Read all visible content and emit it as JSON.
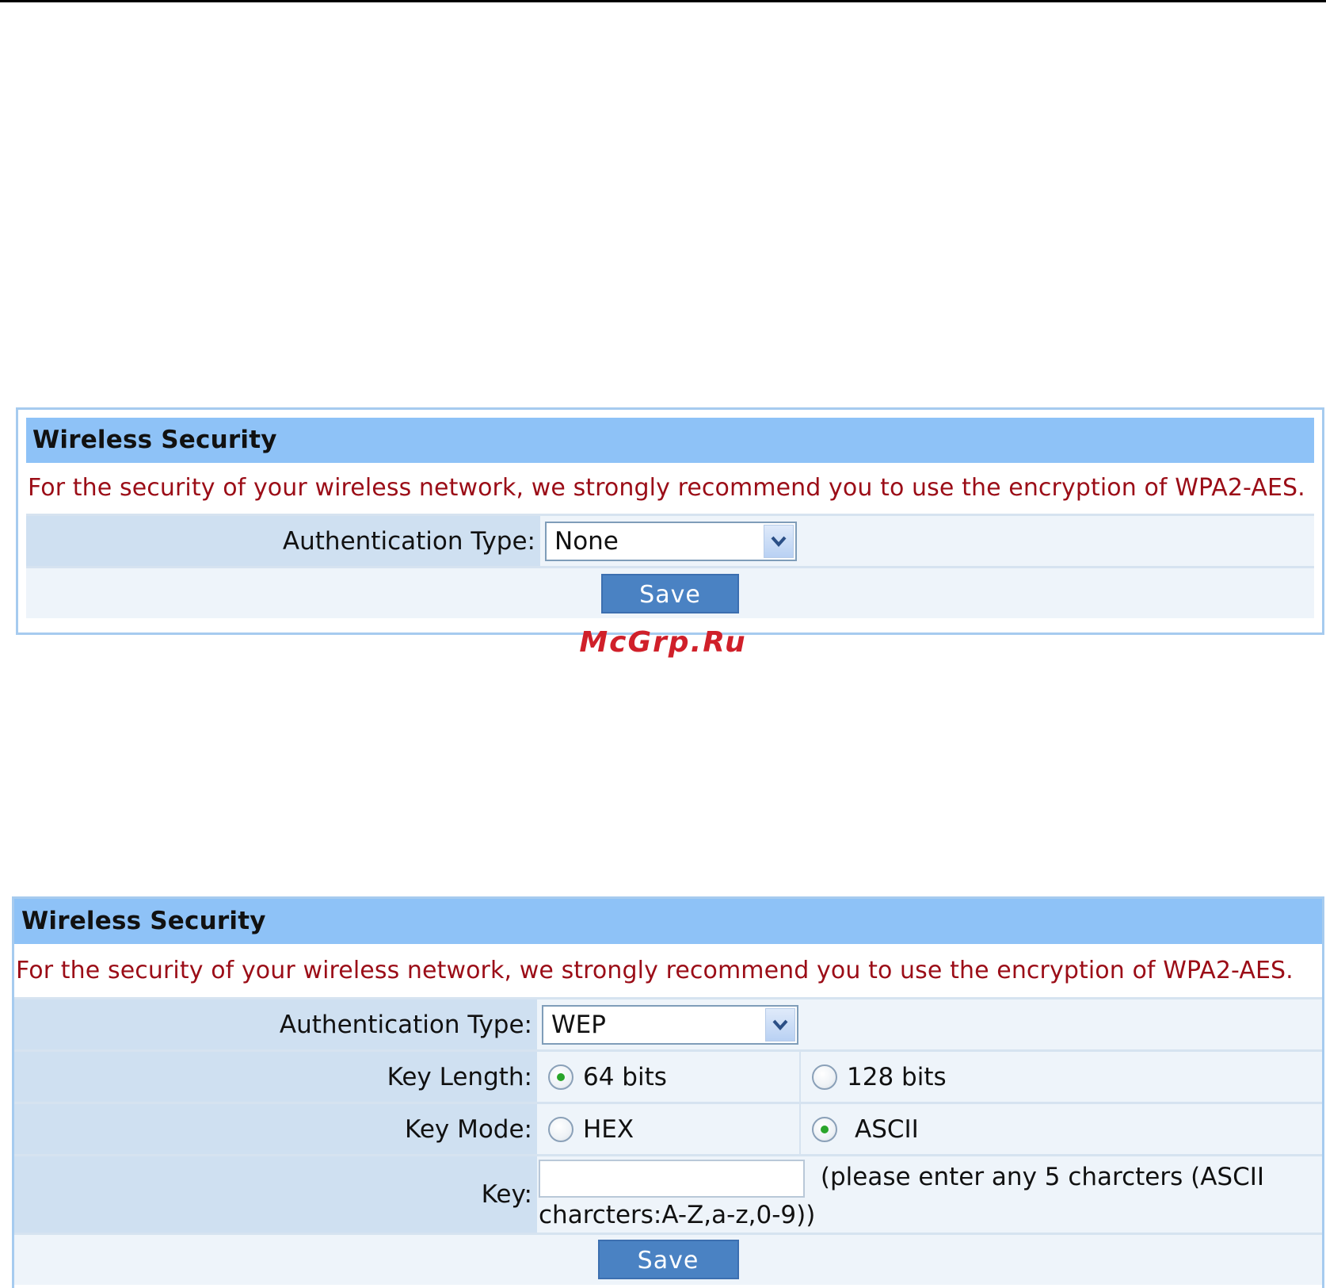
{
  "watermark": "McGrp.Ru",
  "colors": {
    "title_bar": "#8ec2f7",
    "notice_text": "#9b0d17",
    "save_button": "#4a82c3",
    "label_cell": "#cfe0f1",
    "value_cell": "#eef4fa",
    "watermark": "#d0202a"
  },
  "panel1": {
    "title": "Wireless Security",
    "notice": "For the security of your wireless network, we strongly recommend you to use the encryption of WPA2-AES.",
    "auth_type_label": "Authentication Type:",
    "auth_type_value": "None",
    "save_label": "Save"
  },
  "panel2": {
    "title": "Wireless Security",
    "notice": "For the security of your wireless network, we strongly recommend you to use the encryption of WPA2-AES.",
    "auth_type_label": "Authentication Type:",
    "auth_type_value": "WEP",
    "key_length_label": "Key Length:",
    "key_length_options": [
      {
        "label": "64 bits",
        "selected": true
      },
      {
        "label": "128 bits",
        "selected": false
      }
    ],
    "key_mode_label": "Key Mode:",
    "key_mode_options": [
      {
        "label": "HEX",
        "selected": false
      },
      {
        "label": "ASCII",
        "selected": true
      }
    ],
    "key_label": "Key:",
    "key_value": "",
    "key_hint_1": "(please enter any 5 charcters (ASCII",
    "key_hint_2": "charcters:A-Z,a-z,0-9))",
    "save_label": "Save"
  },
  "icons": {
    "dropdown": "chevron-down-icon"
  }
}
